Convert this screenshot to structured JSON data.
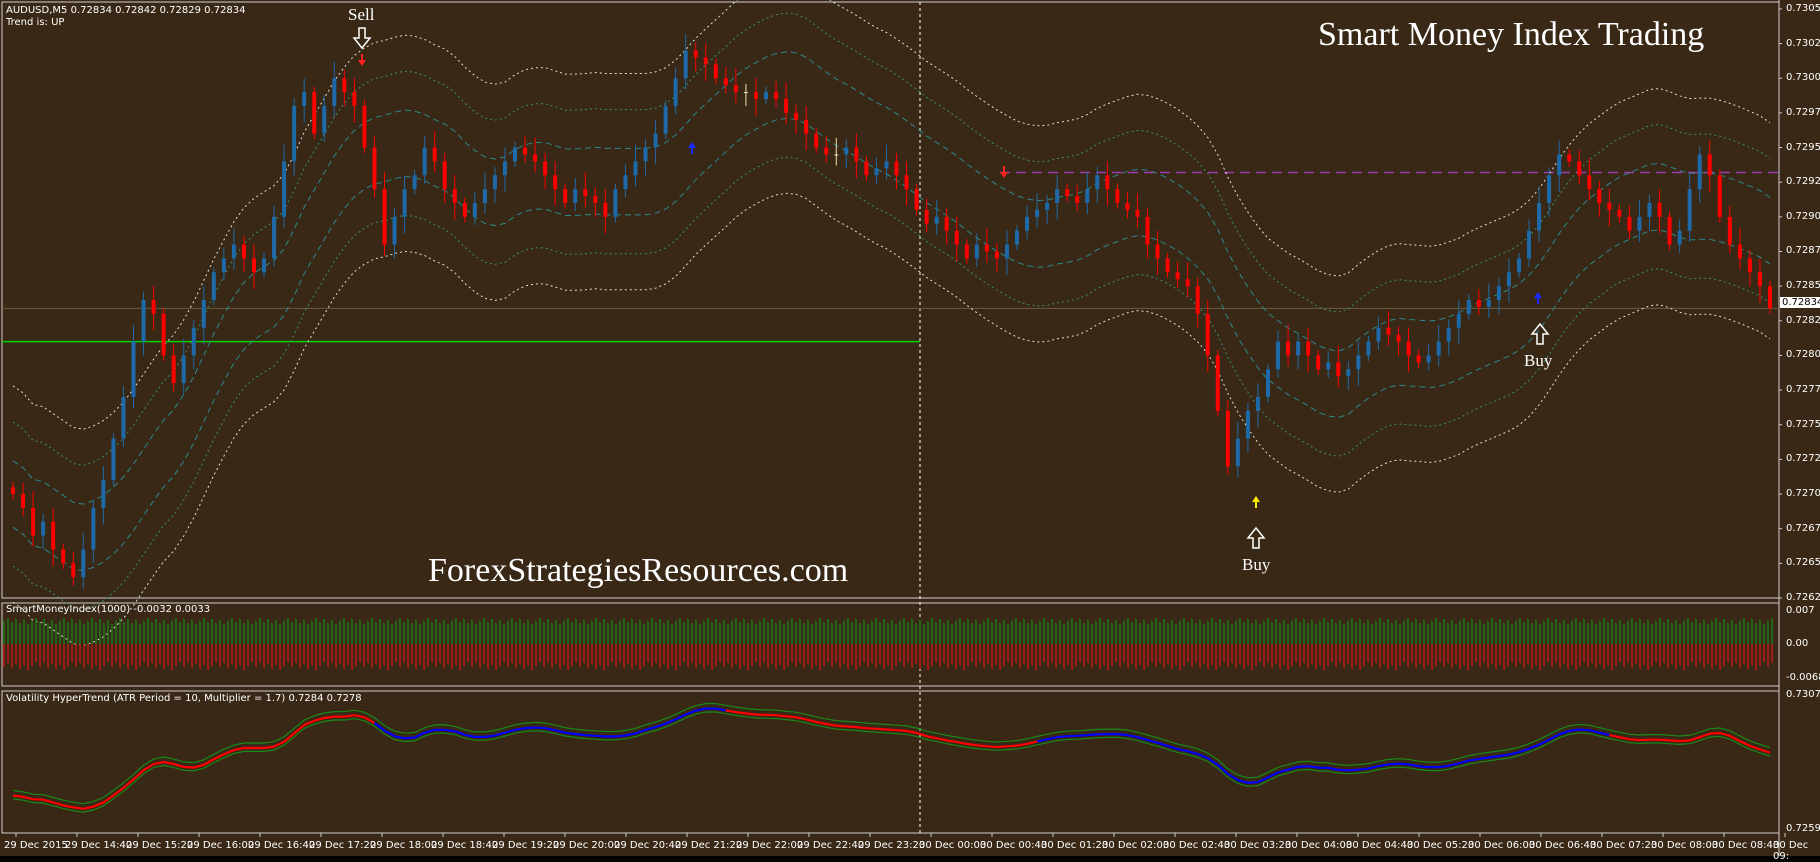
{
  "header": {
    "symbol_line": "AUDUSD,M5  0.72834 0.72842 0.72829 0.72834",
    "trend_line": "Trend is:  UP"
  },
  "title": "Smart Money Index Trading",
  "watermark": "ForexStrategiesResources.com",
  "signals": {
    "sell": "Sell",
    "buy_1": "Buy",
    "buy_2": "Buy"
  },
  "price_axis": [
    "0.73050",
    "0.73025",
    "0.73000",
    "0.72975",
    "0.72950",
    "0.72925",
    "0.72900",
    "0.72875",
    "0.72850",
    "0.72825",
    "0.72800",
    "0.72775",
    "0.72750",
    "0.72725",
    "0.72700",
    "0.72675",
    "0.72650",
    "0.72625"
  ],
  "current_price": "0.72834",
  "smi_panel": {
    "label": "SmartMoneyIndex(1000) -0.0032 0.0033",
    "axis": [
      "0.007",
      "0.00",
      "-0.0068"
    ]
  },
  "vht_panel": {
    "label": "Volatility HyperTrend (ATR Period = 10, Multiplier = 1.7) 0.7284 0.7278",
    "axis": [
      "0.7307",
      "0.7259"
    ]
  },
  "time_axis": [
    "29 Dec 2015",
    "29 Dec 14:40",
    "29 Dec 15:20",
    "29 Dec 16:00",
    "29 Dec 16:40",
    "29 Dec 17:20",
    "29 Dec 18:00",
    "29 Dec 18:40",
    "29 Dec 19:20",
    "29 Dec 20:00",
    "29 Dec 20:40",
    "29 Dec 21:20",
    "29 Dec 22:00",
    "29 Dec 22:40",
    "29 Dec 23:20",
    "30 Dec 00:00",
    "30 Dec 00:40",
    "30 Dec 01:20",
    "30 Dec 02:00",
    "30 Dec 02:40",
    "30 Dec 03:20",
    "30 Dec 04:00",
    "30 Dec 04:40",
    "30 Dec 05:20",
    "30 Dec 06:00",
    "30 Dec 06:40",
    "30 Dec 07:20",
    "30 Dec 08:00",
    "30 Dec 08:40",
    "30 Dec 09:"
  ],
  "colors": {
    "background": "#382815",
    "bull_candle": "#1e6aa8",
    "bear_candle": "#ff0000",
    "doji": "#f0e0b0",
    "band_white": "#ffffff",
    "band_teal": "#2a9aa0",
    "band_green": "#3aa080",
    "resistance": "#9a3ab0",
    "support": "#00d000",
    "smi_pos": "#1c7a1c",
    "smi_neg": "#c01818",
    "vht_blue": "#0000ff",
    "vht_red": "#ff0000",
    "vht_green": "#1a8a1a"
  },
  "chart_data": {
    "type": "candlestick",
    "symbol": "AUDUSD",
    "timeframe": "M5",
    "ylim": [
      0.72625,
      0.73055
    ],
    "x_start": "29 Dec 2015 13:55",
    "x_end": "30 Dec 09:00",
    "resistance_level": 0.72932,
    "support_level": 0.7281,
    "closes": [
      0.727,
      0.7269,
      0.7267,
      0.7268,
      0.7266,
      0.7265,
      0.7264,
      0.7266,
      0.7269,
      0.7271,
      0.7274,
      0.7277,
      0.7281,
      0.7284,
      0.7283,
      0.728,
      0.7278,
      0.728,
      0.7282,
      0.7284,
      0.7286,
      0.7287,
      0.7288,
      0.7287,
      0.7286,
      0.7287,
      0.729,
      0.7294,
      0.7298,
      0.7299,
      0.7296,
      0.7298,
      0.73,
      0.7299,
      0.7298,
      0.7295,
      0.7292,
      0.7288,
      0.729,
      0.7292,
      0.7293,
      0.7295,
      0.7294,
      0.7292,
      0.7291,
      0.729,
      0.7291,
      0.7292,
      0.7293,
      0.7294,
      0.7295,
      0.72945,
      0.7294,
      0.7293,
      0.7292,
      0.7291,
      0.7292,
      0.72915,
      0.7291,
      0.729,
      0.7292,
      0.7293,
      0.7294,
      0.7295,
      0.7296,
      0.7298,
      0.73,
      0.7302,
      0.73015,
      0.7301,
      0.73,
      0.72995,
      0.7299,
      0.7299,
      0.72985,
      0.7299,
      0.72985,
      0.72975,
      0.7297,
      0.7296,
      0.7295,
      0.72945,
      0.72945,
      0.7295,
      0.7294,
      0.7293,
      0.72935,
      0.7294,
      0.7293,
      0.7292,
      0.72905,
      0.72895,
      0.729,
      0.7289,
      0.7288,
      0.7287,
      0.7288,
      0.72875,
      0.7287,
      0.7288,
      0.7289,
      0.729,
      0.72905,
      0.7291,
      0.7292,
      0.72915,
      0.7291,
      0.7292,
      0.7293,
      0.7292,
      0.7291,
      0.72905,
      0.729,
      0.7288,
      0.7287,
      0.7286,
      0.72855,
      0.7285,
      0.7283,
      0.728,
      0.7276,
      0.7272,
      0.7274,
      0.7276,
      0.7277,
      0.7279,
      0.7281,
      0.728,
      0.7281,
      0.728,
      0.7279,
      0.72795,
      0.72785,
      0.7279,
      0.728,
      0.7281,
      0.7282,
      0.72815,
      0.7281,
      0.728,
      0.72795,
      0.728,
      0.7281,
      0.7282,
      0.7283,
      0.7284,
      0.72835,
      0.7284,
      0.7285,
      0.7286,
      0.7287,
      0.7289,
      0.7291,
      0.7293,
      0.72945,
      0.7294,
      0.7293,
      0.7292,
      0.7291,
      0.72905,
      0.729,
      0.7289,
      0.729,
      0.7291,
      0.729,
      0.7288,
      0.7289,
      0.7292,
      0.72945,
      0.7293,
      0.729,
      0.7288,
      0.7287,
      0.7286,
      0.7285,
      0.72834
    ]
  }
}
